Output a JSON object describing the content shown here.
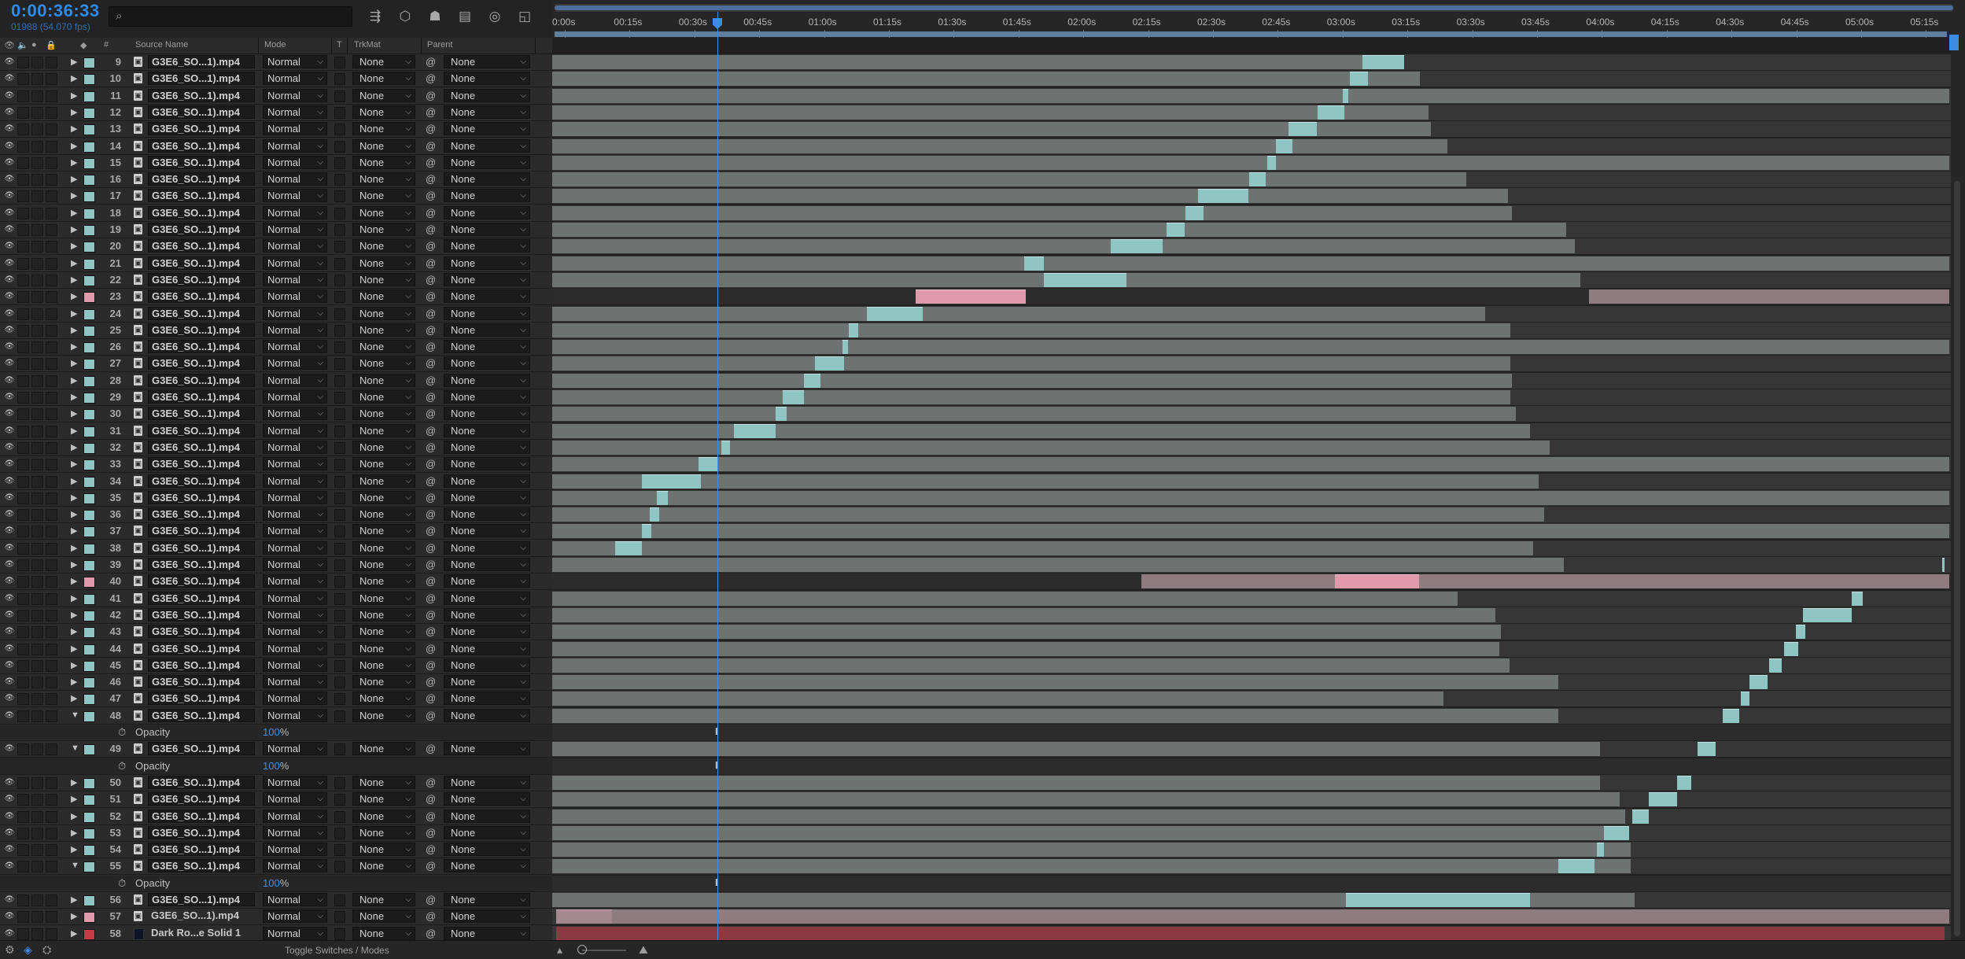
{
  "header": {
    "timecode": "0:00:36:33",
    "fps_line": "01988 (54.070 fps)",
    "search_placeholder": "",
    "tool_icons": [
      "composition-mini-flowchart-icon",
      "draft-3d-icon",
      "shy-layers-icon",
      "frame-blending-icon",
      "motion-blur-icon",
      "graph-editor-icon"
    ]
  },
  "columns": {
    "number": "#",
    "source_name": "Source Name",
    "mode": "Mode",
    "t": "T",
    "trkmat": "TrkMat",
    "parent": "Parent"
  },
  "ruler": {
    "ticks": [
      "0:00s",
      "00:15s",
      "00:30s",
      "00:45s",
      "01:00s",
      "01:15s",
      "01:30s",
      "01:45s",
      "02:00s",
      "02:15s",
      "02:30s",
      "02:45s",
      "03:00s",
      "03:15s",
      "03:30s",
      "03:45s",
      "04:00s",
      "04:15s",
      "04:30s",
      "04:45s",
      "05:00s",
      "05:15s"
    ]
  },
  "layers": [
    {
      "kind": "layer",
      "num": "9",
      "name": "G3E6_SO...1).mp4",
      "mode": "Normal",
      "trkmat": "None",
      "parent": "None",
      "label": "teal",
      "bar": [
        0,
        1.61
      ],
      "clip": [
        1.58,
        1.61
      ]
    },
    {
      "kind": "layer",
      "num": "10",
      "name": "G3E6_SO...1).mp4",
      "mode": "Normal",
      "trkmat": "None",
      "parent": "None",
      "label": "teal",
      "bar": [
        0,
        1.621
      ],
      "clip": [
        1.571,
        1.584
      ]
    },
    {
      "kind": "layer",
      "num": "11",
      "name": "G3E6_SO...1).mp4",
      "mode": "Normal",
      "trkmat": "None",
      "parent": "None",
      "label": "teal",
      "bar": [
        0,
        1.0
      ],
      "clip": [
        1.566,
        1.57
      ]
    },
    {
      "kind": "layer",
      "num": "12",
      "name": "G3E6_SO...1).mp4",
      "mode": "Normal",
      "trkmat": "None",
      "parent": "None",
      "label": "teal",
      "bar": [
        0,
        1.627
      ],
      "clip": [
        1.548,
        1.567
      ]
    },
    {
      "kind": "layer",
      "num": "13",
      "name": "G3E6_SO...1).mp4",
      "mode": "Normal",
      "trkmat": "None",
      "parent": "None",
      "label": "teal",
      "bar": [
        0,
        1.629
      ],
      "clip": [
        1.527,
        1.547
      ]
    },
    {
      "kind": "layer",
      "num": "14",
      "name": "G3E6_SO...1).mp4",
      "mode": "Normal",
      "trkmat": "None",
      "parent": "None",
      "label": "teal",
      "bar": [
        0,
        1.641
      ],
      "clip": [
        1.518,
        1.53
      ]
    },
    {
      "kind": "layer",
      "num": "15",
      "name": "G3E6_SO...1).mp4",
      "mode": "Normal",
      "trkmat": "None",
      "parent": "None",
      "label": "teal",
      "bar": [
        0,
        0.992
      ],
      "clip": [
        1.512,
        1.518
      ]
    },
    {
      "kind": "layer",
      "num": "16",
      "name": "G3E6_SO...1).mp4",
      "mode": "Normal",
      "trkmat": "None",
      "parent": "None",
      "label": "teal",
      "bar": [
        0,
        1.654
      ],
      "clip": [
        1.499,
        1.511
      ]
    },
    {
      "kind": "layer",
      "num": "17",
      "name": "G3E6_SO...1).mp4",
      "mode": "Normal",
      "trkmat": "None",
      "parent": "None",
      "label": "teal",
      "bar": [
        0,
        1.684
      ],
      "clip": [
        1.462,
        1.498
      ]
    },
    {
      "kind": "layer",
      "num": "18",
      "name": "G3E6_SO...1).mp4",
      "mode": "Normal",
      "trkmat": "None",
      "parent": "None",
      "label": "teal",
      "bar": [
        0,
        1.687
      ],
      "clip": [
        1.453,
        1.466
      ]
    },
    {
      "kind": "layer",
      "num": "19",
      "name": "G3E6_SO...1).mp4",
      "mode": "Normal",
      "trkmat": "None",
      "parent": "None",
      "label": "teal",
      "bar": [
        0,
        1.726
      ],
      "clip": [
        1.44,
        1.453
      ]
    },
    {
      "kind": "layer",
      "num": "20",
      "name": "G3E6_SO...1).mp4",
      "mode": "Normal",
      "trkmat": "None",
      "parent": "None",
      "label": "teal",
      "bar": [
        0,
        1.732
      ],
      "clip": [
        1.4,
        1.437
      ]
    },
    {
      "kind": "layer",
      "num": "21",
      "name": "G3E6_SO...1).mp4",
      "mode": "Normal",
      "trkmat": "None",
      "parent": "None",
      "label": "teal",
      "bar": [
        0,
        1.0
      ],
      "clip": [
        1.338,
        1.352
      ]
    },
    {
      "kind": "layer",
      "num": "22",
      "name": "G3E6_SO...1).mp4",
      "mode": "Normal",
      "trkmat": "None",
      "parent": "None",
      "label": "teal",
      "bar": [
        0,
        1.736
      ],
      "clip": [
        1.352,
        1.411
      ]
    },
    {
      "kind": "layer",
      "num": "23",
      "name": "G3E6_SO...1).mp4",
      "mode": "Normal",
      "trkmat": "None",
      "parent": "None",
      "label": "pink",
      "dark": true,
      "pinkbar": [
        0.742,
        1.0
      ],
      "clip": [
        1.26,
        1.339
      ],
      "clipcolor": "pink"
    },
    {
      "kind": "layer",
      "num": "24",
      "name": "G3E6_SO...1).mp4",
      "mode": "Normal",
      "trkmat": "None",
      "parent": "None",
      "label": "teal",
      "bar": [
        0,
        1.668
      ],
      "clip": [
        1.225,
        1.265
      ]
    },
    {
      "kind": "layer",
      "num": "25",
      "name": "G3E6_SO...1).mp4",
      "mode": "Normal",
      "trkmat": "None",
      "parent": "None",
      "label": "teal",
      "bar": [
        0,
        1.686
      ],
      "clip": [
        1.212,
        1.219
      ]
    },
    {
      "kind": "layer",
      "num": "26",
      "name": "G3E6_SO...1).mp4",
      "mode": "Normal",
      "trkmat": "None",
      "parent": "None",
      "label": "teal",
      "bar": [
        0,
        1.0
      ],
      "clip": [
        1.208,
        1.212
      ]
    },
    {
      "kind": "layer",
      "num": "27",
      "name": "G3E6_SO...1).mp4",
      "mode": "Normal",
      "trkmat": "None",
      "parent": "None",
      "label": "teal",
      "bar": [
        0,
        1.686
      ],
      "clip": [
        1.188,
        1.209
      ]
    },
    {
      "kind": "layer",
      "num": "28",
      "name": "G3E6_SO...1).mp4",
      "mode": "Normal",
      "trkmat": "None",
      "parent": "None",
      "label": "teal",
      "bar": [
        0,
        1.687
      ],
      "clip": [
        1.18,
        1.192
      ]
    },
    {
      "kind": "layer",
      "num": "29",
      "name": "G3E6_SO...1).mp4",
      "mode": "Normal",
      "trkmat": "None",
      "parent": "None",
      "label": "teal",
      "bar": [
        0,
        1.686
      ],
      "clip": [
        1.165,
        1.18
      ]
    },
    {
      "kind": "layer",
      "num": "30",
      "name": "G3E6_SO...1).mp4",
      "mode": "Normal",
      "trkmat": "None",
      "parent": "None",
      "label": "teal",
      "bar": [
        0,
        1.69
      ],
      "clip": [
        1.16,
        1.168
      ]
    },
    {
      "kind": "layer",
      "num": "31",
      "name": "G3E6_SO...1).mp4",
      "mode": "Normal",
      "trkmat": "None",
      "parent": "None",
      "label": "teal",
      "bar": [
        0,
        1.7
      ],
      "clip": [
        1.13,
        1.16
      ]
    },
    {
      "kind": "layer",
      "num": "32",
      "name": "G3E6_SO...1).mp4",
      "mode": "Normal",
      "trkmat": "None",
      "parent": "None",
      "label": "teal",
      "bar": [
        0,
        1.714
      ],
      "clip": [
        1.121,
        1.127
      ]
    },
    {
      "kind": "layer",
      "num": "33",
      "name": "G3E6_SO...1).mp4",
      "mode": "Normal",
      "trkmat": "None",
      "parent": "None",
      "label": "teal",
      "bar": [
        0,
        1.0
      ],
      "clip": [
        1.105,
        1.119
      ]
    },
    {
      "kind": "layer",
      "num": "34",
      "name": "G3E6_SO...1).mp4",
      "mode": "Normal",
      "trkmat": "None",
      "parent": "None",
      "label": "teal",
      "bar": [
        0,
        1.706
      ],
      "clip": [
        1.064,
        1.106
      ]
    },
    {
      "kind": "layer",
      "num": "35",
      "name": "G3E6_SO...1).mp4",
      "mode": "Normal",
      "trkmat": "None",
      "parent": "None",
      "label": "teal",
      "bar": [
        0,
        1.0
      ],
      "clip": [
        1.075,
        1.083
      ]
    },
    {
      "kind": "layer",
      "num": "36",
      "name": "G3E6_SO...1).mp4",
      "mode": "Normal",
      "trkmat": "None",
      "parent": "None",
      "label": "teal",
      "bar": [
        0,
        1.71
      ],
      "clip": [
        1.07,
        1.077
      ]
    },
    {
      "kind": "layer",
      "num": "37",
      "name": "G3E6_SO...1).mp4",
      "mode": "Normal",
      "trkmat": "None",
      "parent": "None",
      "label": "teal",
      "bar": [
        0,
        1.0
      ],
      "clip": [
        1.064,
        1.071
      ]
    },
    {
      "kind": "layer",
      "num": "38",
      "name": "G3E6_SO...1).mp4",
      "mode": "Normal",
      "trkmat": "None",
      "parent": "None",
      "label": "teal",
      "bar": [
        0,
        1.702
      ],
      "clip": [
        1.045,
        1.064
      ]
    },
    {
      "kind": "layer",
      "num": "39",
      "name": "G3E6_SO...1).mp4",
      "mode": "Normal",
      "trkmat": "None",
      "parent": "None",
      "label": "teal",
      "bar": [
        0,
        1.724
      ],
      "clip": [
        0.995,
        1.045
      ]
    },
    {
      "kind": "layer",
      "num": "40",
      "name": "G3E6_SO...1).mp4",
      "mode": "Normal",
      "trkmat": "None",
      "parent": "None",
      "label": "pink",
      "dark": true,
      "pinkbar": [
        0.422,
        1.0
      ],
      "clip": [
        0.56,
        0.62
      ],
      "clipcolor": "pink"
    },
    {
      "kind": "layer",
      "num": "41",
      "name": "G3E6_SO...1).mp4",
      "mode": "Normal",
      "trkmat": "None",
      "parent": "None",
      "label": "teal",
      "bar": [
        0,
        1.648
      ],
      "clip": [
        0.93,
        0.938
      ]
    },
    {
      "kind": "layer",
      "num": "42",
      "name": "G3E6_SO...1).mp4",
      "mode": "Normal",
      "trkmat": "None",
      "parent": "None",
      "label": "teal",
      "bar": [
        0,
        1.675
      ],
      "clip": [
        0.895,
        0.93
      ]
    },
    {
      "kind": "layer",
      "num": "43",
      "name": "G3E6_SO...1).mp4",
      "mode": "Normal",
      "trkmat": "None",
      "parent": "None",
      "label": "teal",
      "bar": [
        0,
        1.679
      ],
      "clip": [
        0.89,
        0.897
      ]
    },
    {
      "kind": "layer",
      "num": "44",
      "name": "G3E6_SO...1).mp4",
      "mode": "Normal",
      "trkmat": "None",
      "parent": "None",
      "label": "teal",
      "bar": [
        0,
        1.678
      ],
      "clip": [
        0.882,
        0.892
      ]
    },
    {
      "kind": "layer",
      "num": "45",
      "name": "G3E6_SO...1).mp4",
      "mode": "Normal",
      "trkmat": "None",
      "parent": "None",
      "label": "teal",
      "bar": [
        0,
        1.685
      ],
      "clip": [
        0.871,
        0.88
      ]
    },
    {
      "kind": "layer",
      "num": "46",
      "name": "G3E6_SO...1).mp4",
      "mode": "Normal",
      "trkmat": "None",
      "parent": "None",
      "label": "teal",
      "bar": [
        0,
        1.72
      ],
      "clip": [
        0.857,
        0.87
      ]
    },
    {
      "kind": "layer",
      "num": "47",
      "name": "G3E6_SO...1).mp4",
      "mode": "Normal",
      "trkmat": "None",
      "parent": "None",
      "label": "teal",
      "bar": [
        0,
        1.638
      ],
      "clip": [
        0.851,
        0.857
      ]
    },
    {
      "kind": "layer",
      "num": "48",
      "name": "G3E6_SO...1).mp4",
      "mode": "Normal",
      "trkmat": "None",
      "parent": "None",
      "label": "teal",
      "expanded": true,
      "bar": [
        0,
        1.72
      ],
      "clip": [
        0.838,
        0.85
      ]
    },
    {
      "kind": "prop",
      "name": "Opacity",
      "value": "100",
      "unit": "%"
    },
    {
      "kind": "layer",
      "num": "49",
      "name": "G3E6_SO...1).mp4",
      "mode": "Normal",
      "trkmat": "None",
      "parent": "None",
      "label": "teal",
      "expanded": true,
      "bar": [
        0,
        1.75
      ],
      "clip": [
        0.82,
        0.833
      ]
    },
    {
      "kind": "prop",
      "name": "Opacity",
      "value": "100",
      "unit": "%"
    },
    {
      "kind": "layer",
      "num": "50",
      "name": "G3E6_SO...1).mp4",
      "mode": "Normal",
      "trkmat": "None",
      "parent": "None",
      "label": "teal",
      "bar": [
        0,
        1.75
      ],
      "clip": [
        0.805,
        0.815
      ]
    },
    {
      "kind": "layer",
      "num": "51",
      "name": "G3E6_SO...1).mp4",
      "mode": "Normal",
      "trkmat": "None",
      "parent": "None",
      "label": "teal",
      "bar": [
        0,
        1.764
      ],
      "clip": [
        0.785,
        0.805
      ]
    },
    {
      "kind": "layer",
      "num": "52",
      "name": "G3E6_SO...1).mp4",
      "mode": "Normal",
      "trkmat": "None",
      "parent": "None",
      "label": "teal",
      "bar": [
        0,
        1.768
      ],
      "clip": [
        0.773,
        0.785
      ]
    },
    {
      "kind": "layer",
      "num": "53",
      "name": "G3E6_SO...1).mp4",
      "mode": "Normal",
      "trkmat": "None",
      "parent": "None",
      "label": "teal",
      "bar": [
        0,
        1.768
      ],
      "clip": [
        0.753,
        0.771
      ]
    },
    {
      "kind": "layer",
      "num": "54",
      "name": "G3E6_SO...1).mp4",
      "mode": "Normal",
      "trkmat": "None",
      "parent": "None",
      "label": "teal",
      "bar": [
        0,
        1.772
      ],
      "clip": [
        0.748,
        0.753
      ]
    },
    {
      "kind": "layer",
      "num": "55",
      "name": "G3E6_SO...1).mp4",
      "mode": "Normal",
      "trkmat": "None",
      "parent": "None",
      "label": "teal",
      "expanded": true,
      "bar": [
        0,
        1.772
      ],
      "clip": [
        0.72,
        0.746
      ]
    },
    {
      "kind": "prop",
      "name": "Opacity",
      "value": "100",
      "unit": "%"
    },
    {
      "kind": "layer",
      "num": "56",
      "name": "G3E6_SO...1).mp4",
      "mode": "Normal",
      "trkmat": "None",
      "parent": "None",
      "label": "teal",
      "bar": [
        0,
        1.775
      ],
      "clip": [
        0.568,
        0.7
      ]
    },
    {
      "kind": "layer",
      "num": "57",
      "name": "G3E6_SO...1).mp4",
      "mode": "Normal",
      "trkmat": "None",
      "parent": "None",
      "label": "pink",
      "plainname": true,
      "pinkbar": [
        0.003,
        1.0
      ],
      "clip": [
        0.003,
        0.043
      ],
      "clipcolor": "pinkmuted"
    },
    {
      "kind": "layer",
      "num": "58",
      "name": "Dark Ro...e Solid 1",
      "mode": "Normal",
      "trkmat": "None",
      "parent": "None",
      "label": "red",
      "plainname": true,
      "solid": true,
      "redbar": [
        0.003,
        0.997
      ]
    }
  ],
  "bottom": {
    "toggle_label": "Toggle Switches / Modes"
  },
  "colors": {
    "accent": "#2d8ceb",
    "teal_label": "#8fc6c3",
    "pink_label": "#e199ad",
    "red_label": "#c23b47"
  }
}
